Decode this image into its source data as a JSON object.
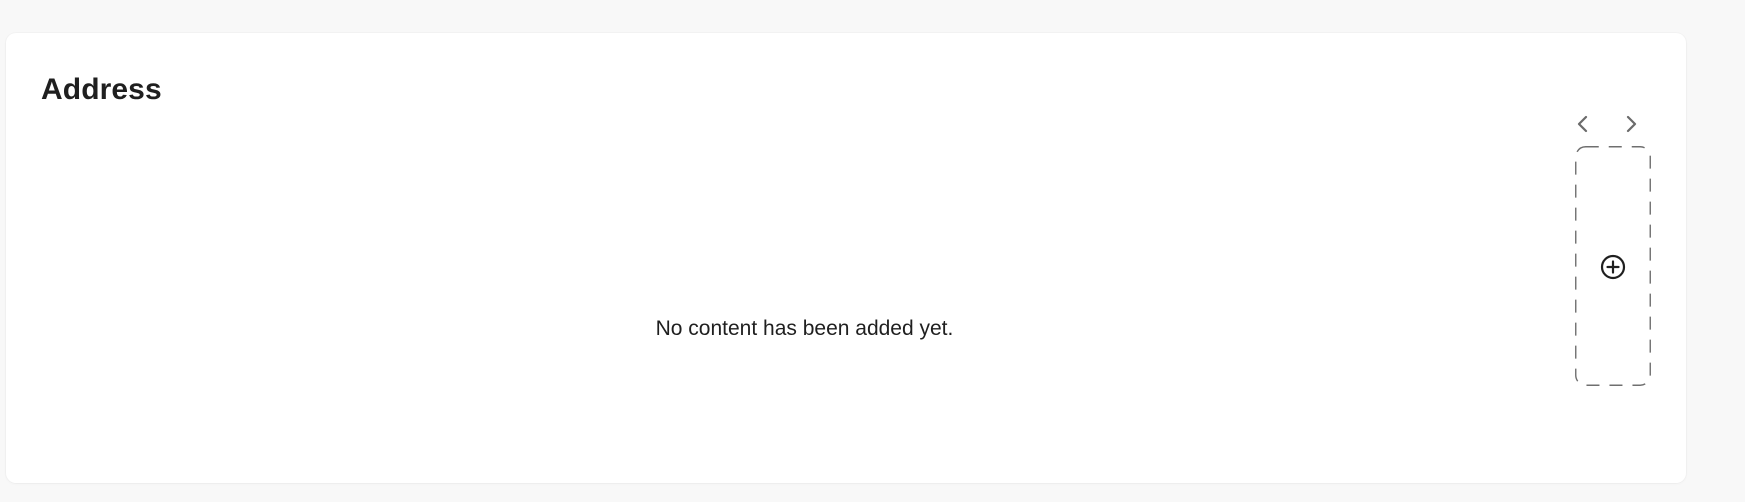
{
  "section": {
    "title": "Address",
    "empty_message": "No content has been added yet."
  },
  "navigation": {
    "prev_icon": "chevron-left-icon",
    "next_icon": "chevron-right-icon"
  },
  "add_slot": {
    "icon": "plus-circle-icon"
  },
  "colors": {
    "background": "#f8f8f8",
    "card": "#ffffff",
    "text": "#1f1f1f",
    "icon_muted": "#6b6b6b",
    "dashed_border": "#6f6f6f"
  }
}
